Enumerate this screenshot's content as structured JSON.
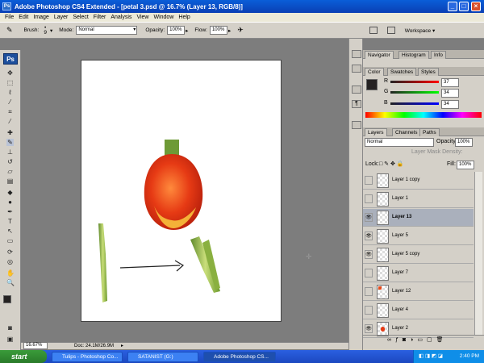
{
  "app": {
    "title": "Adobe Photoshop CS4 Extended - [petal 3.psd @ 16.7% (Layer 13, RGB/8)]"
  },
  "menu": [
    "File",
    "Edit",
    "Image",
    "Layer",
    "Select",
    "Filter",
    "Analysis",
    "View",
    "Window",
    "Help"
  ],
  "options": {
    "brush_label": "Brush:",
    "brush_size": "9",
    "mode_label": "Mode:",
    "mode_value": "Normal",
    "opacity_label": "Opacity:",
    "opacity_value": "100%",
    "flow_label": "Flow:",
    "flow_value": "100%",
    "workspace_label": "Workspace"
  },
  "status": {
    "zoom": "16.67%",
    "doc": "Doc: 24.1M/26.9M"
  },
  "panels": {
    "top_tabs": [
      "Navigator",
      "Histogram",
      "Info"
    ],
    "color_tabs": [
      "Color",
      "Swatches",
      "Styles"
    ],
    "color": {
      "r_label": "R",
      "r_value": "37",
      "g_label": "G",
      "g_value": "34",
      "b_label": "B",
      "b_value": "34"
    },
    "layers_tabs": [
      "Layers",
      "Channels",
      "Paths"
    ],
    "blend_mode": "Normal",
    "opacity_label": "Opacity:",
    "opacity_value": "100%",
    "mask_density_label": "Layer Mask Density:",
    "lock_label": "Lock:",
    "fill_label": "Fill:",
    "fill_value": "100%"
  },
  "layers": [
    {
      "name": "Layer 1 copy",
      "visible": false,
      "selected": false
    },
    {
      "name": "Layer 1",
      "visible": false,
      "selected": false
    },
    {
      "name": "Layer 13",
      "visible": true,
      "selected": true
    },
    {
      "name": "Layer 5",
      "visible": true,
      "selected": false
    },
    {
      "name": "Layer 5 copy",
      "visible": true,
      "selected": false
    },
    {
      "name": "Layer 7",
      "visible": false,
      "selected": false
    },
    {
      "name": "Layer 12",
      "visible": false,
      "selected": false
    },
    {
      "name": "Layer 4",
      "visible": false,
      "selected": false
    },
    {
      "name": "Layer 2",
      "visible": true,
      "selected": false
    }
  ],
  "taskbar": {
    "start": "start",
    "items": [
      "Tulips - Photoshop Co...",
      "SATANIST (G:)",
      "Adobe Photoshop CS..."
    ],
    "time": "2:40 PM"
  },
  "colors": {
    "titlebar": "#0a4ec8",
    "selected_layer": "#aab0bc",
    "workspace": "#7d7d7d"
  }
}
